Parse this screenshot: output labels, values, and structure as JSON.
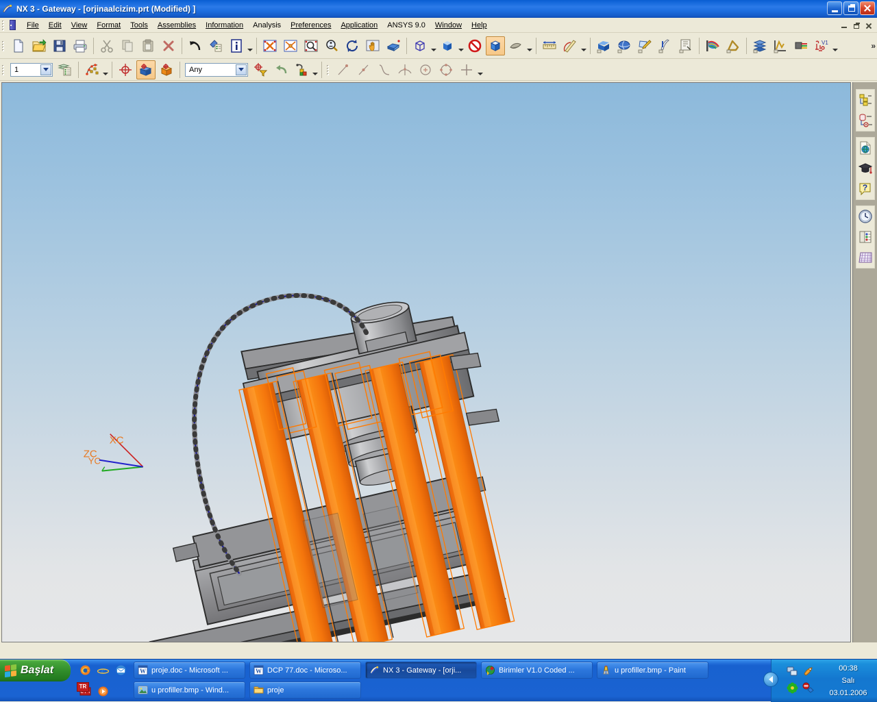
{
  "window": {
    "title": "NX 3 - Gateway - [orjinaalcizim.prt (Modified) ]",
    "app_icon": "nx-icon",
    "buttons": {
      "minimize": "minimize-icon",
      "maximize": "maximize-icon",
      "close": "close-icon"
    }
  },
  "menubar": {
    "items": [
      {
        "label": "File",
        "accel": "F"
      },
      {
        "label": "Edit",
        "accel": "E"
      },
      {
        "label": "View",
        "accel": "V"
      },
      {
        "label": "Format",
        "accel": "r"
      },
      {
        "label": "Tools",
        "accel": "T"
      },
      {
        "label": "Assemblies",
        "accel": "A"
      },
      {
        "label": "Information",
        "accel": "I"
      },
      {
        "label": "Analysis",
        "accel": ""
      },
      {
        "label": "Preferences",
        "accel": "P"
      },
      {
        "label": "Application",
        "accel": "n"
      },
      {
        "label": "ANSYS 9.0",
        "accel": ""
      },
      {
        "label": "Window",
        "accel": "w"
      },
      {
        "label": "Help",
        "accel": "H"
      }
    ],
    "mdi_buttons": {
      "minimize": "mdi-minimize-icon",
      "restore": "mdi-restore-icon",
      "close": "mdi-close-icon"
    }
  },
  "toolbar_standard": {
    "groups": [
      {
        "buttons": [
          {
            "name": "new-file-button",
            "icon": "new-document-icon",
            "tooltip": "New"
          },
          {
            "name": "open-file-button",
            "icon": "open-folder-icon",
            "tooltip": "Open"
          },
          {
            "name": "save-button",
            "icon": "floppy-disk-icon",
            "tooltip": "Save"
          },
          {
            "name": "print-button",
            "icon": "printer-icon",
            "tooltip": "Print"
          }
        ]
      },
      {
        "buttons": [
          {
            "name": "cut-button",
            "icon": "scissors-icon",
            "tooltip": "Cut"
          },
          {
            "name": "copy-button",
            "icon": "copy-pages-icon",
            "tooltip": "Copy"
          },
          {
            "name": "paste-button",
            "icon": "clipboard-icon",
            "tooltip": "Paste"
          },
          {
            "name": "delete-button",
            "icon": "red-x-icon",
            "tooltip": "Delete"
          }
        ]
      },
      {
        "buttons": [
          {
            "name": "undo-button",
            "icon": "undo-arrow-icon",
            "tooltip": "Undo"
          },
          {
            "name": "object-display-button",
            "icon": "paint-list-icon",
            "tooltip": "Edit Object Display"
          },
          {
            "name": "information-button",
            "icon": "info-i-icon",
            "tooltip": "Information"
          }
        ]
      },
      {
        "buttons": [
          {
            "name": "fit-view-button",
            "icon": "fit-window-icon",
            "tooltip": "Fit"
          },
          {
            "name": "zoom-region-button",
            "icon": "zoom-star-icon",
            "tooltip": "Zoom"
          },
          {
            "name": "zoom-window-button",
            "icon": "magnifier-box-icon",
            "tooltip": "Zoom Window"
          },
          {
            "name": "zoom-in-out-button",
            "icon": "magnifier-plusminus-icon",
            "tooltip": "Zoom In/Out"
          },
          {
            "name": "rotate-button",
            "icon": "rotate-arrows-icon",
            "tooltip": "Rotate"
          },
          {
            "name": "pan-button",
            "icon": "pan-hand-icon",
            "tooltip": "Pan"
          },
          {
            "name": "perspective-button",
            "icon": "perspective-cube-icon",
            "tooltip": "Perspective"
          }
        ]
      },
      {
        "buttons": [
          {
            "name": "orient-view-button",
            "icon": "wireframe-cube-icon",
            "tooltip": "Orient View",
            "dropdown": true
          },
          {
            "name": "shaded-view-button",
            "icon": "blue-cube-icon",
            "tooltip": "Shaded",
            "dropdown": true
          },
          {
            "name": "no-section-button",
            "icon": "no-entry-icon",
            "tooltip": "Clip Section"
          },
          {
            "name": "shade-mode-button",
            "icon": "shaded-cube-icon",
            "tooltip": "Shaded with Edges",
            "active": true
          },
          {
            "name": "layer-visible-button",
            "icon": "layer-stack-icon",
            "tooltip": "Layer Settings",
            "dropdown": true
          }
        ]
      },
      {
        "buttons": [
          {
            "name": "measure-distance-button",
            "icon": "ruler-icon",
            "tooltip": "Measure Distance"
          },
          {
            "name": "measure-angle-button",
            "icon": "protractor-icon",
            "tooltip": "Measure Angle",
            "dropdown": true
          }
        ]
      },
      {
        "buttons": [
          {
            "name": "extrude-button",
            "icon": "extrude-block-icon",
            "tooltip": "Extrude"
          },
          {
            "name": "free-form-button",
            "icon": "freeform-surface-icon",
            "tooltip": "Free Form"
          },
          {
            "name": "sketch-button",
            "icon": "sketch-pencil-icon",
            "tooltip": "Sketch"
          },
          {
            "name": "feature-button",
            "icon": "feather-feature-icon",
            "tooltip": "Feature Operation"
          },
          {
            "name": "drafting-button",
            "icon": "drafting-sheet-icon",
            "tooltip": "Drafting"
          }
        ]
      },
      {
        "buttons": [
          {
            "name": "flow-analysis-button",
            "icon": "rainbow-flow-icon",
            "tooltip": "Flow Analysis"
          },
          {
            "name": "mechanism-button",
            "icon": "linkage-arm-icon",
            "tooltip": "Mechanism"
          }
        ]
      },
      {
        "buttons": [
          {
            "name": "mold-wizard-button",
            "icon": "layer-plates-icon",
            "tooltip": "Mold Wizard"
          },
          {
            "name": "graph-button",
            "icon": "graph-spike-icon",
            "tooltip": "Graphing"
          },
          {
            "name": "wiring-button",
            "icon": "wire-harness-icon",
            "tooltip": "Routing"
          },
          {
            "name": "schematic-button",
            "icon": "schematic-v1-icon",
            "tooltip": "Schematic"
          }
        ]
      }
    ],
    "overflow_label": "»"
  },
  "toolbar_selection": {
    "layer_combo": {
      "value": "1",
      "name": "work-layer-combo"
    },
    "layer_settings_button": {
      "icon": "layer-list-icon",
      "name": "layer-settings-button"
    },
    "curve_button": {
      "icon": "curve-points-icon",
      "name": "curve-rule-button"
    },
    "snap_point_button": {
      "icon": "snap-point-icon",
      "name": "snap-point-button"
    },
    "face_select_button": {
      "icon": "face-select-icon",
      "name": "face-select-button",
      "active": true
    },
    "body_select_button": {
      "icon": "body-select-icon",
      "name": "body-select-button"
    },
    "type_filter_combo": {
      "value": "Any",
      "name": "type-filter-combo"
    },
    "filter_button": {
      "icon": "snap-filter-icon",
      "name": "snap-filter-button"
    },
    "back_button": {
      "icon": "green-back-arrow-icon",
      "name": "back-arrow-button"
    },
    "selection_tools_button": {
      "icon": "selection-tools-icon",
      "name": "selection-tools-button"
    },
    "snap_group": [
      {
        "name": "snap-endpoint-button",
        "icon": "endpoint-icon"
      },
      {
        "name": "snap-midpoint-button",
        "icon": "midpoint-icon"
      },
      {
        "name": "snap-control-point-button",
        "icon": "control-point-icon"
      },
      {
        "name": "snap-intersection-button",
        "icon": "intersection-icon"
      },
      {
        "name": "snap-arc-center-button",
        "icon": "arc-center-icon"
      },
      {
        "name": "snap-quadrant-button",
        "icon": "quadrant-point-icon"
      },
      {
        "name": "snap-existing-point-button",
        "icon": "existing-point-icon"
      }
    ]
  },
  "viewport": {
    "name": "graphics-viewport",
    "background_top": "#8cb9db",
    "background_bottom": "#e6e7e8",
    "wcs_labels": {
      "x": "XC",
      "z": "ZC",
      "y": "YC"
    },
    "wcs_colors": {
      "x_axis": "#cc2222",
      "y_axis": "#22aa22",
      "z_axis": "#2222cc",
      "label": "#e87820"
    },
    "model": {
      "description": "Hydraulic press assembly, shaded-with-edges, rotated view",
      "body_color": "#8c8c8c",
      "highlight_color": "#f57c00",
      "edge_color": "#3a3a3a",
      "spline_color": "#1a1a9c"
    }
  },
  "resource_bar": {
    "name": "resource-bar",
    "groups": [
      {
        "items": [
          {
            "name": "assembly-navigator-icon",
            "label": "Assembly Navigator"
          },
          {
            "name": "part-navigator-icon",
            "label": "Part Navigator"
          }
        ]
      },
      {
        "items": [
          {
            "name": "web-browser-icon",
            "label": "Internet Explorer"
          },
          {
            "name": "learning-cap-icon",
            "label": "Tutorial"
          },
          {
            "name": "help-question-icon",
            "label": "Help"
          }
        ]
      },
      {
        "items": [
          {
            "name": "history-clock-icon",
            "label": "History"
          },
          {
            "name": "palette-book-icon",
            "label": "Palettes"
          },
          {
            "name": "spreadsheet-grid-icon",
            "label": "Roles"
          }
        ]
      }
    ]
  },
  "taskbar": {
    "start_label": "Başlat",
    "quick_launch": [
      {
        "name": "firefox-icon",
        "label": "Mozilla Firefox"
      },
      {
        "name": "internet-explorer-icon",
        "label": "Internet Explorer"
      },
      {
        "name": "outlook-express-icon",
        "label": "Outlook Express"
      },
      {
        "name": "command-prompt-icon",
        "label": "Command Prompt"
      },
      {
        "name": "media-player-icon",
        "label": "Windows Media Player"
      }
    ],
    "tasks_row1": [
      {
        "label": "proje.doc - Microsoft ...",
        "icon": "word-doc-icon",
        "active": false
      },
      {
        "label": "DCP 77.doc - Microso...",
        "icon": "word-doc-icon",
        "active": false
      },
      {
        "label": "NX 3 - Gateway - [orji...",
        "icon": "nx-icon",
        "active": true
      },
      {
        "label": "Birimler V1.0  Coded ...",
        "icon": "globe-app-icon",
        "active": false
      },
      {
        "label": "u profiller.bmp - Paint",
        "icon": "paint-icon",
        "active": false
      }
    ],
    "tasks_row2": [
      {
        "label": "u profiller.bmp - Wind...",
        "icon": "picture-viewer-icon",
        "active": false
      },
      {
        "label": "proje",
        "icon": "folder-icon",
        "active": false
      }
    ],
    "tray": {
      "icons": [
        {
          "name": "network-connection-icon",
          "label": "Local Area Connection"
        },
        {
          "name": "safely-remove-icon",
          "label": "Safely Remove Hardware"
        },
        {
          "name": "icq-flower-icon",
          "label": "ICQ"
        },
        {
          "name": "antivirus-shield-icon",
          "label": "Antivirus"
        }
      ],
      "language_indicator": "TR",
      "time": "00:38",
      "day": "Salı",
      "date": "03.01.2006"
    }
  }
}
